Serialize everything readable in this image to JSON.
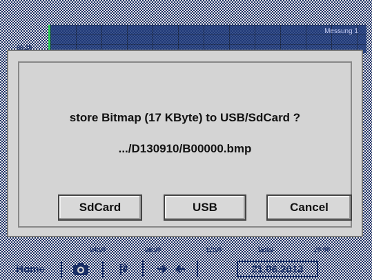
{
  "background": {
    "chart_tag": "Messung 1",
    "y_label": "90.18",
    "time_ticks": [
      "04:00",
      "08:00",
      "12:00",
      "16:00",
      "20:00"
    ]
  },
  "dialog": {
    "message": "store Bitmap (17 KByte) to USB/SdCard ?",
    "path": ".../D130910/B00000.bmp",
    "buttons": {
      "sdcard": "SdCard",
      "usb": "USB",
      "cancel": "Cancel"
    }
  },
  "bottombar": {
    "home_label": "Home",
    "date": "21.06.2013",
    "icons": [
      "camera-icon",
      "antenna-icon",
      "arrows-icon"
    ]
  },
  "colors": {
    "dialog_bg": "#d4d4d4",
    "accent_navy": "#1a2f66",
    "graph_green": "#1fd44a"
  }
}
